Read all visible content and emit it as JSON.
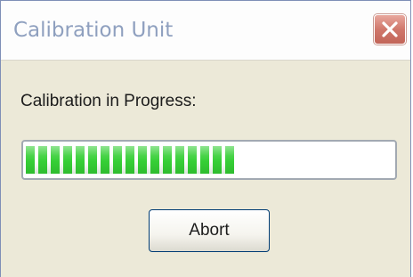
{
  "window": {
    "title": "Calibration Unit"
  },
  "icons": {
    "close": "close-icon"
  },
  "status": {
    "label": "Calibration in Progress:"
  },
  "progress": {
    "percent": 57
  },
  "buttons": {
    "abort_label": "Abort"
  },
  "colors": {
    "progress_fill": "#36cf36",
    "close_button": "#d0776b",
    "title_text": "#8fa0bf",
    "window_background": "#ece9d8"
  }
}
